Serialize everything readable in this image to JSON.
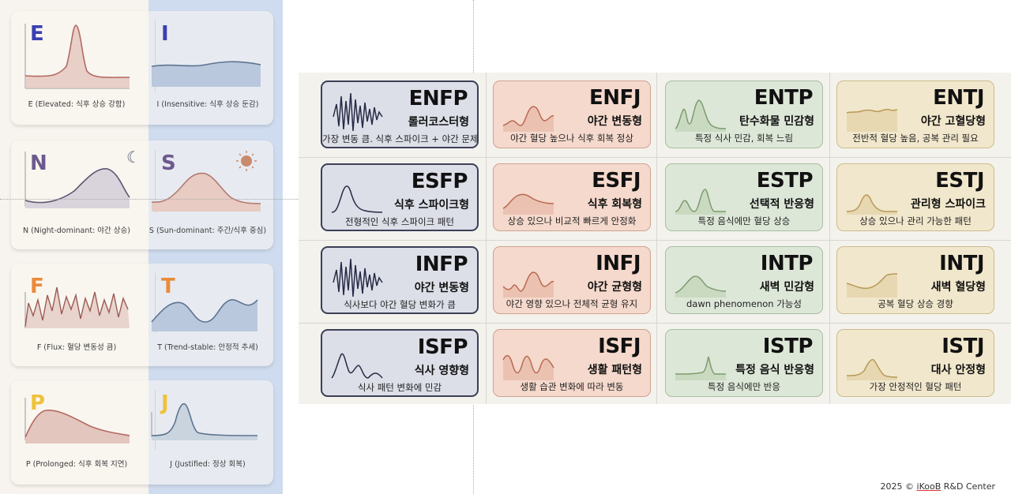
{
  "axes": [
    {
      "left_letter": "E",
      "left_caption": "E (Elevated: 식후 상승 강함)",
      "right_letter": "I",
      "right_caption": "I (Insensitive: 식후 상승 둔감)",
      "left_color": "#3b3fb3",
      "right_color": "#3b3fb3"
    },
    {
      "left_letter": "N",
      "left_caption": "N (Night-dominant: 야간 상승)",
      "right_letter": "S",
      "right_caption": "S (Sun-dominant: 주간/식후 중심)",
      "left_color": "#6c5a8e",
      "right_color": "#6c5a8e"
    },
    {
      "left_letter": "F",
      "left_caption": "F (Flux: 혈당 변동성 큼)",
      "right_letter": "T",
      "right_caption": "T (Trend-stable: 안정적 추세)",
      "left_color": "#e98a3a",
      "right_color": "#e98a3a"
    },
    {
      "left_letter": "P",
      "left_caption": "P (Prolonged: 식후 회복 지연)",
      "right_letter": "J",
      "right_caption": "J (Justified: 정상 회복)",
      "left_color": "#efc23b",
      "right_color": "#efc23b"
    }
  ],
  "types": [
    [
      {
        "type": "ENFP",
        "name": "롤러코스터형",
        "desc": "가장 변동 큼. 식후 스파이크 + 야간 문제"
      },
      {
        "type": "ENFJ",
        "name": "야간 변동형",
        "desc": "야간 혈당 높으나 식후 회복 정상"
      },
      {
        "type": "ENTP",
        "name": "탄수화물 민감형",
        "desc": "특정 식사 민감, 회복 느림"
      },
      {
        "type": "ENTJ",
        "name": "야간 고혈당형",
        "desc": "전반적 혈당 높음, 공복 관리 필요"
      }
    ],
    [
      {
        "type": "ESFP",
        "name": "식후 스파이크형",
        "desc": "전형적인 식후 스파이크 패턴"
      },
      {
        "type": "ESFJ",
        "name": "식후 회복형",
        "desc": "상승 있으나 비교적 빠르게 안정화"
      },
      {
        "type": "ESTP",
        "name": "선택적 반응형",
        "desc": "특정 음식에만 혈당 상승"
      },
      {
        "type": "ESTJ",
        "name": "관리형 스파이크",
        "desc": "상승 있으나 관리 가능한 패턴"
      }
    ],
    [
      {
        "type": "INFP",
        "name": "야간 변동형",
        "desc": "식사보다 야간 혈당 변화가 큼"
      },
      {
        "type": "INFJ",
        "name": "야간 균형형",
        "desc": "야간 영향 있으나 전체적 균형 유지"
      },
      {
        "type": "INTP",
        "name": "새벽 민감형",
        "desc": "dawn phenomenon 가능성"
      },
      {
        "type": "INTJ",
        "name": "새벽 혈당형",
        "desc": "공복 혈당 상승 경향"
      }
    ],
    [
      {
        "type": "ISFP",
        "name": "식사 영향형",
        "desc": "식사 패턴 변화에 민감"
      },
      {
        "type": "ISFJ",
        "name": "생활 패턴형",
        "desc": "생활 습관 변화에 따라 변동"
      },
      {
        "type": "ISTP",
        "name": "특정 음식 반응형",
        "desc": "특정 음식에만 반응"
      },
      {
        "type": "ISTJ",
        "name": "대사 안정형",
        "desc": "가장 안정적인 혈당 패턴"
      }
    ]
  ],
  "copyright": {
    "prefix": "2025 © ",
    "brand": "iKooB",
    "suffix": " R&D Center"
  },
  "colors": {
    "col0": "#3c3f55",
    "col1": "#c97a5f",
    "col2": "#8fab82",
    "col3": "#c6aa6e"
  }
}
